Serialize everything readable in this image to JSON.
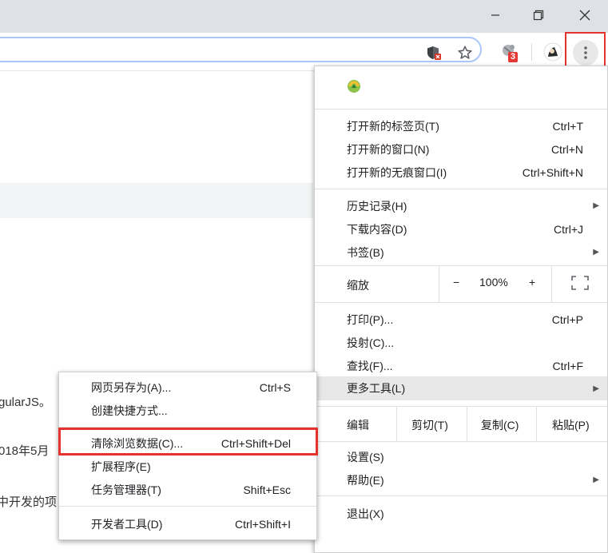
{
  "window_controls": {
    "minimize_icon": "minimize-icon",
    "restore_icon": "restore-icon",
    "close_icon": "close-icon"
  },
  "toolbar": {
    "extension_badge": "3"
  },
  "page": {
    "line1": "gularJS。",
    "line2": "018年5月",
    "line3": "中开发的项"
  },
  "menu": {
    "group1": [
      {
        "label": "打开新的标签页(T)",
        "accel": "Ctrl+T"
      },
      {
        "label": "打开新的窗口(N)",
        "accel": "Ctrl+N"
      },
      {
        "label": "打开新的无痕窗口(I)",
        "accel": "Ctrl+Shift+N"
      }
    ],
    "group2": [
      {
        "label": "历史记录(H)",
        "accel": ""
      },
      {
        "label": "下载内容(D)",
        "accel": "Ctrl+J"
      },
      {
        "label": "书签(B)",
        "accel": ""
      }
    ],
    "zoom": {
      "label": "缩放",
      "minus": "−",
      "value": "100%",
      "plus": "+"
    },
    "group3": [
      {
        "label": "打印(P)...",
        "accel": "Ctrl+P"
      },
      {
        "label": "投射(C)...",
        "accel": ""
      },
      {
        "label": "查找(F)...",
        "accel": "Ctrl+F"
      },
      {
        "label": "更多工具(L)",
        "accel": ""
      }
    ],
    "edit": {
      "label": "编辑",
      "cut": "剪切(T)",
      "copy": "复制(C)",
      "paste": "粘贴(P)"
    },
    "group4": [
      {
        "label": "设置(S)"
      },
      {
        "label": "帮助(E)"
      }
    ],
    "exit": {
      "label": "退出(X)"
    }
  },
  "submenu": {
    "group1": [
      {
        "label": "网页另存为(A)...",
        "accel": "Ctrl+S"
      },
      {
        "label": "创建快捷方式...",
        "accel": ""
      }
    ],
    "group2": [
      {
        "label": "清除浏览数据(C)...",
        "accel": "Ctrl+Shift+Del"
      },
      {
        "label": "扩展程序(E)",
        "accel": ""
      },
      {
        "label": "任务管理器(T)",
        "accel": "Shift+Esc"
      }
    ],
    "group3": [
      {
        "label": "开发者工具(D)",
        "accel": "Ctrl+Shift+I"
      }
    ]
  },
  "colors": {
    "highlight_border": "#e5322d",
    "titlebar": "#dee1e6",
    "hover_row": "#e8e8e8",
    "badge": "#e53935"
  }
}
